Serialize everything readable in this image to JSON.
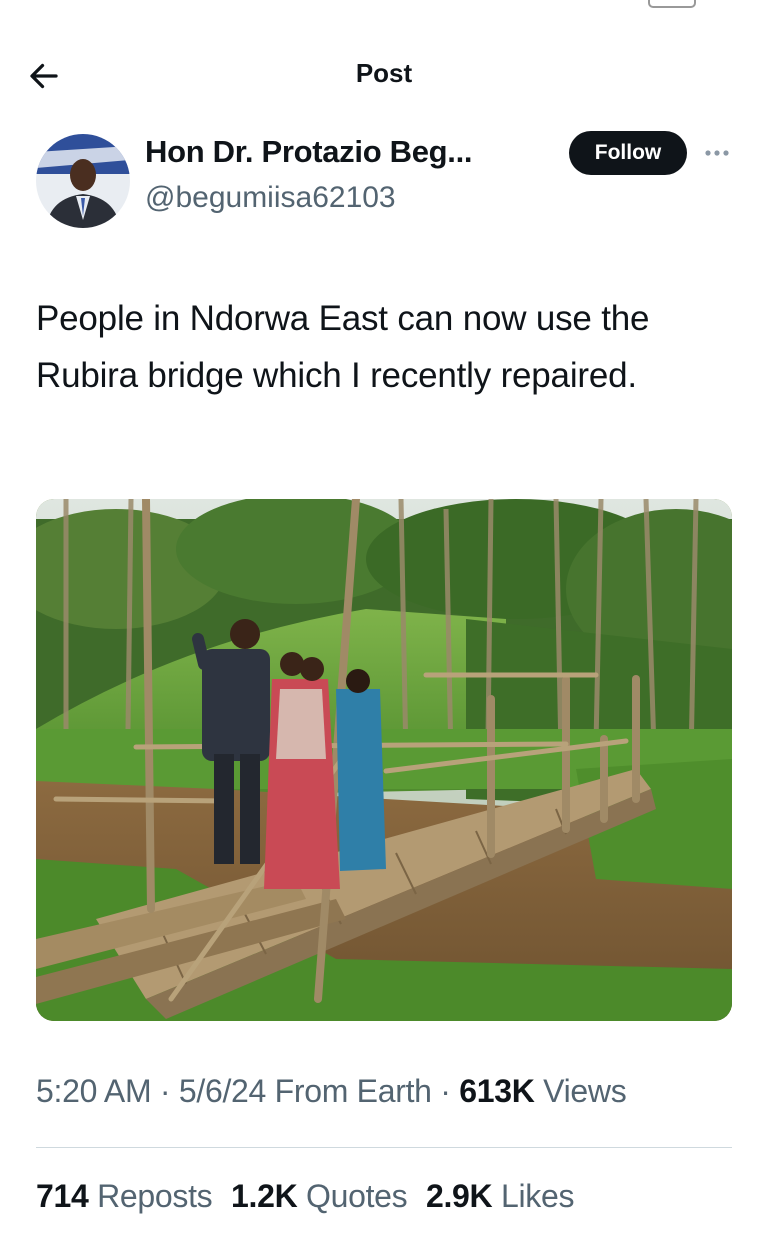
{
  "header": {
    "title": "Post",
    "back_icon": "arrow-left-icon"
  },
  "author": {
    "name": "Hon Dr. Protazio Beg...",
    "handle": "@begumiisa62103",
    "follow_label": "Follow",
    "more_icon": "more-horizontal-icon"
  },
  "tweet": {
    "text": "People in Ndorwa East can now use the Rubira bridge which I recently repaired."
  },
  "meta": {
    "time": "5:20 AM",
    "sep1": " · ",
    "date": "5/6/24",
    "source": " From Earth",
    "sep2": " · ",
    "views_count": "613K",
    "views_label": " Views"
  },
  "stats": {
    "reposts_count": "714",
    "reposts_label": "Reposts",
    "quotes_count": "1.2K",
    "quotes_label": "Quotes",
    "likes_count": "2.9K",
    "likes_label": "Likes"
  },
  "colors": {
    "text_primary": "#0f1419",
    "text_secondary": "#536471",
    "follow_bg": "#0f1419",
    "divider": "#cfd9de"
  }
}
